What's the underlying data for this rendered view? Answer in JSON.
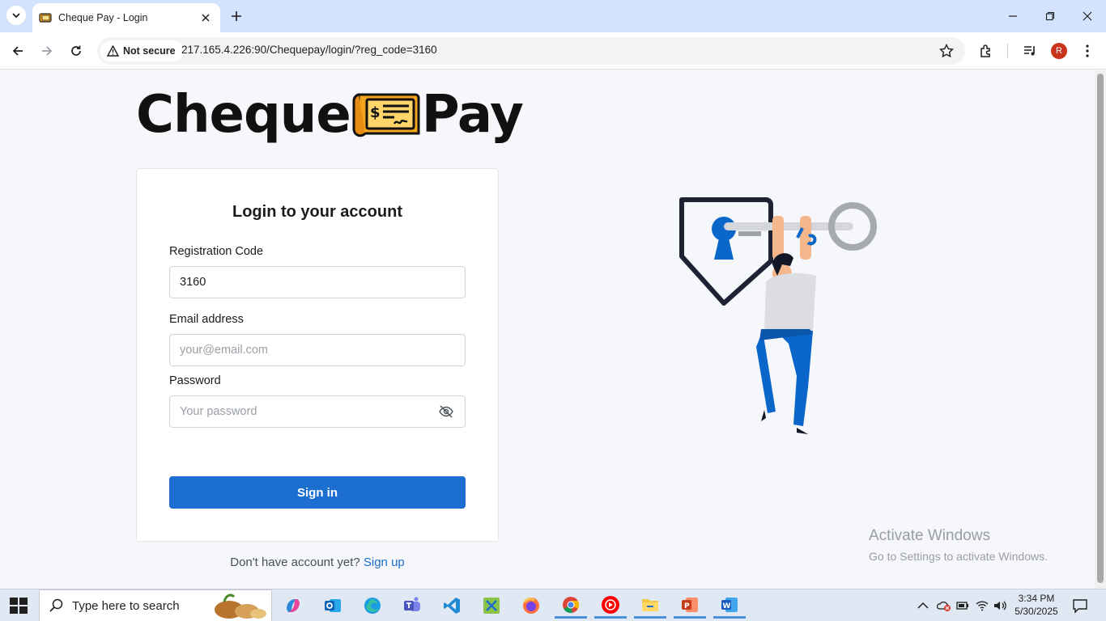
{
  "browser": {
    "tab_title": "Cheque Pay - Login",
    "security_label": "Not secure",
    "url": "217.165.4.226:90/Chequepay/login/?reg_code=3160",
    "profile_initial": "R"
  },
  "logo": {
    "left_word": "Cheque",
    "right_word": "Pay"
  },
  "login": {
    "title": "Login to your account",
    "reg_code_label": "Registration Code",
    "reg_code_value": "3160",
    "email_label": "Email address",
    "email_placeholder": "your@email.com",
    "password_label": "Password",
    "password_placeholder": "Your password",
    "signin_label": "Sign in",
    "signup_prompt": "Don't have account yet?",
    "signup_link": "Sign up"
  },
  "watermark": {
    "line1": "Activate Windows",
    "line2": "Go to Settings to activate Windows."
  },
  "taskbar": {
    "search_placeholder": "Type here to search",
    "time": "3:34 PM",
    "date": "5/30/2025",
    "apps": [
      "copilot-icon",
      "outlook-icon",
      "edge-icon",
      "teams-icon",
      "vscode-icon",
      "tool-icon",
      "firefox-icon",
      "chrome-icon",
      "youtube-music-icon",
      "file-explorer-icon",
      "powerpoint-icon",
      "word-icon"
    ]
  },
  "colors": {
    "primary": "#1c6fd1",
    "tab_bar": "#d3e3fd",
    "page_bg": "#f5f7fa"
  }
}
